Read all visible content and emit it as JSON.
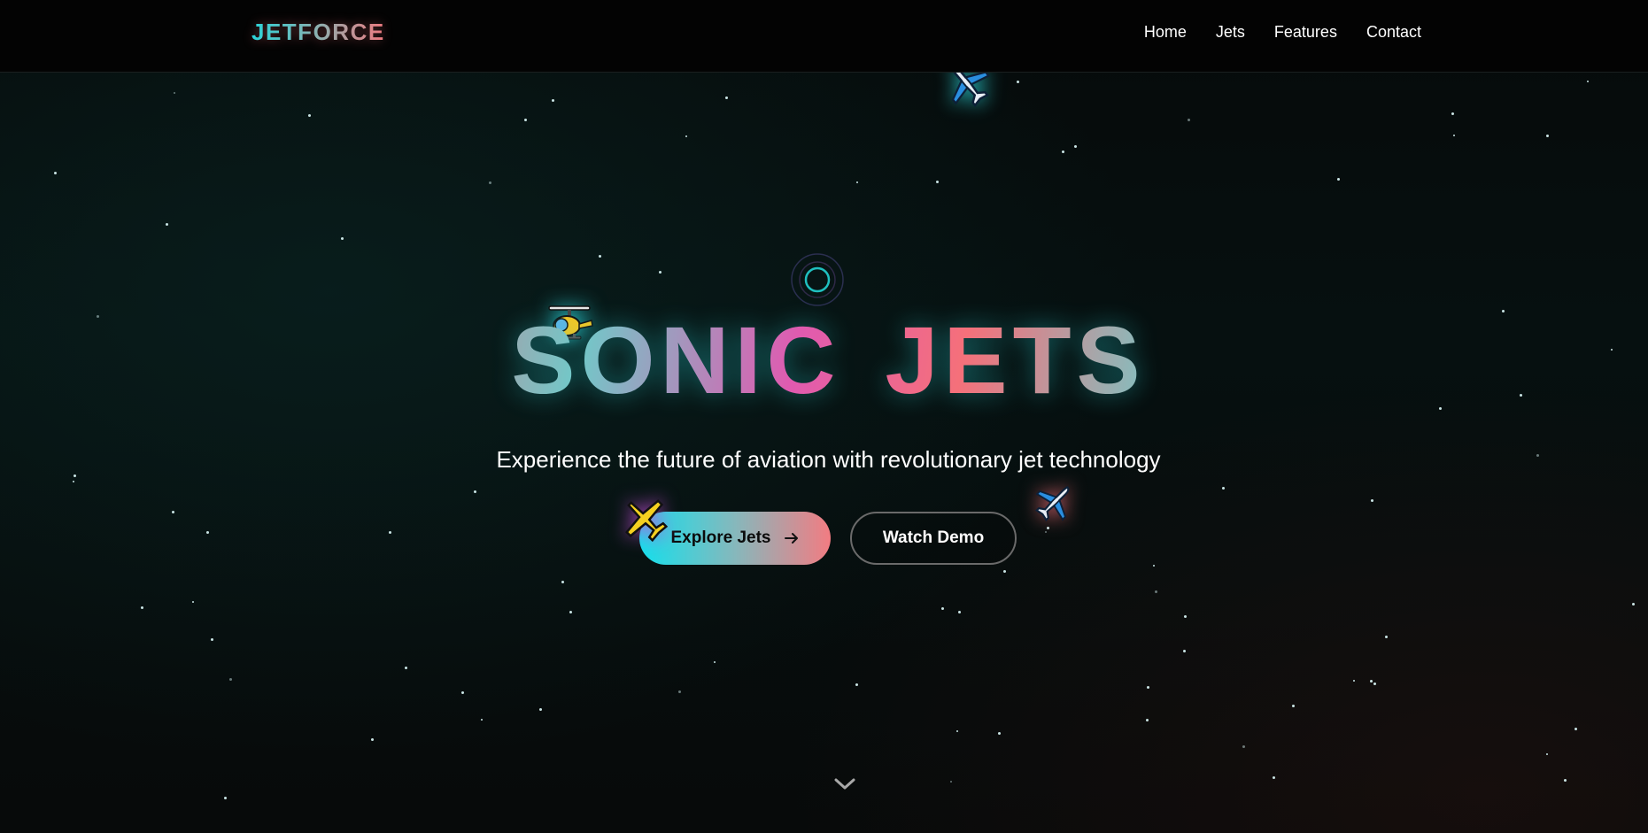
{
  "header": {
    "logo": "JETFORCE",
    "nav": [
      {
        "label": "Home"
      },
      {
        "label": "Jets"
      },
      {
        "label": "Features"
      },
      {
        "label": "Contact"
      }
    ]
  },
  "hero": {
    "title": "SONIC JETS",
    "subtitle": "Experience the future of aviation with revolutionary jet technology",
    "primary_button": "Explore Jets",
    "secondary_button": "Watch Demo"
  },
  "icons": {
    "arrow": "arrow-right-icon",
    "scroll": "chevron-down-icon",
    "ring": "pulse-ring-icon",
    "planes": [
      "airplane-icon",
      "helicopter-icon",
      "small-airplane-icon",
      "airplane-icon"
    ]
  },
  "colors": {
    "accent_cyan": "#14e0ec",
    "accent_coral": "#f27c82",
    "accent_pink": "#e05ab0",
    "background": "#050808"
  }
}
